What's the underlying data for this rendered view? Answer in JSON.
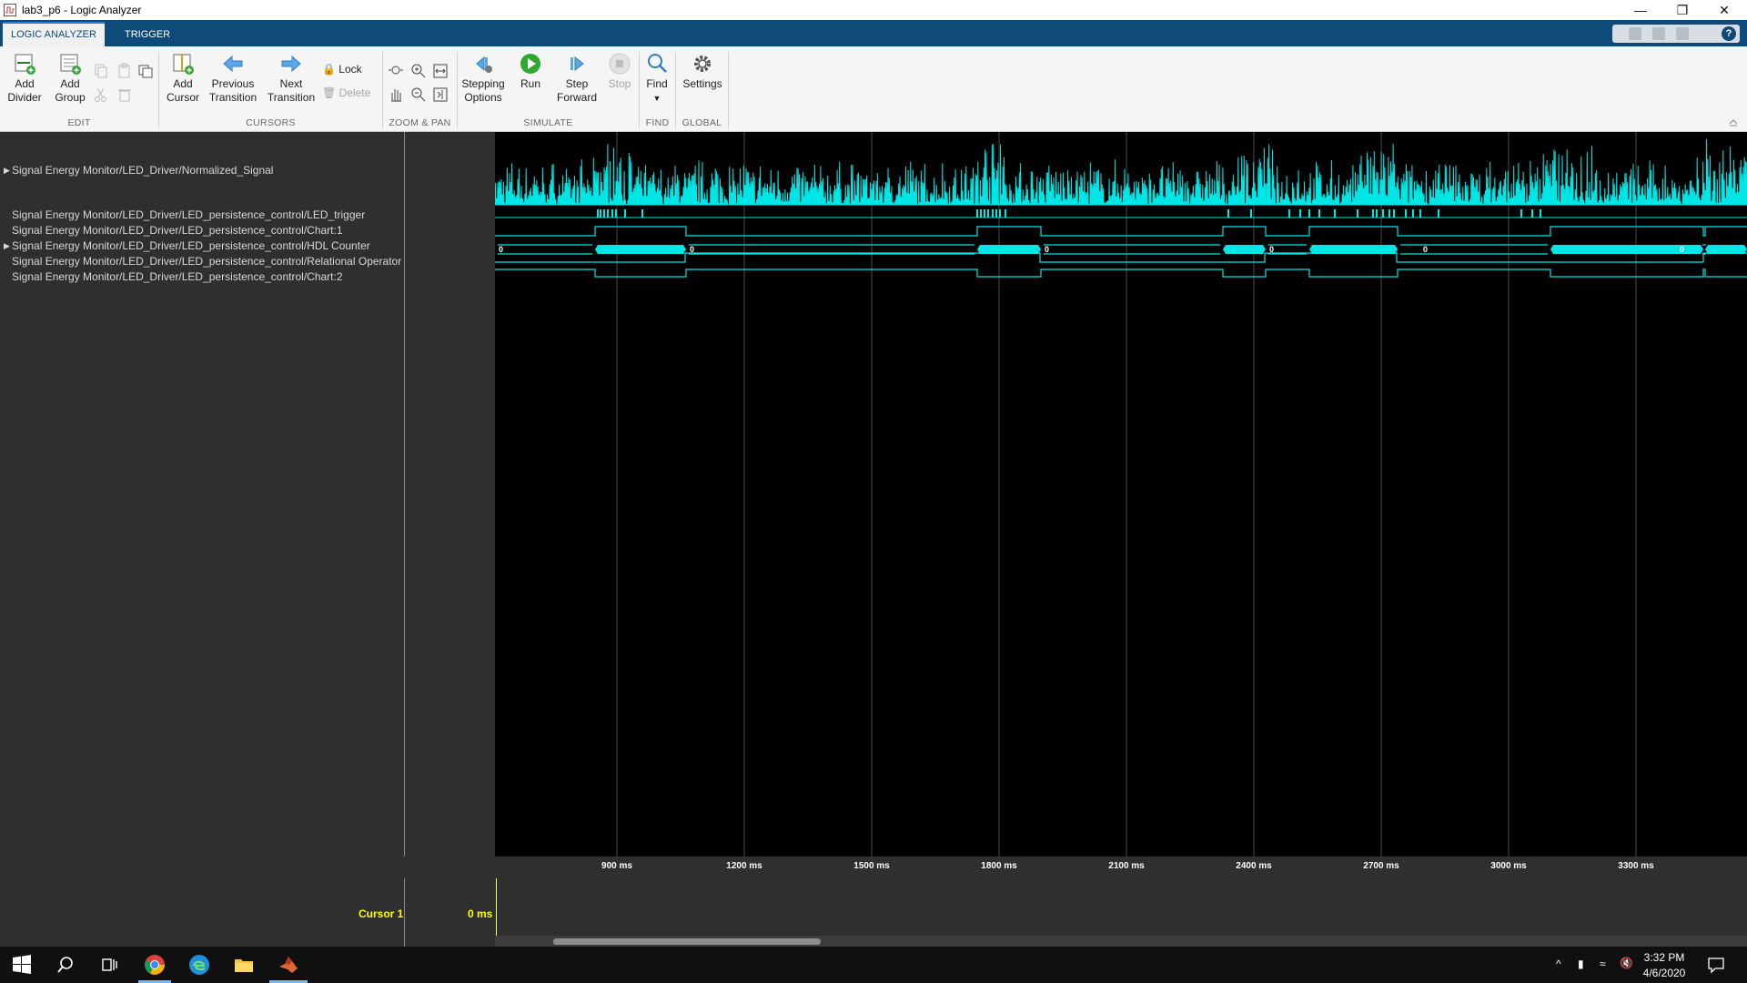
{
  "window": {
    "title": "lab3_p6 - Logic Analyzer",
    "minimize": "—",
    "restore": "❐",
    "close": "✕"
  },
  "tabs": [
    {
      "label": "LOGIC ANALYZER"
    },
    {
      "label": "TRIGGER"
    }
  ],
  "help": "?",
  "toolstrip": {
    "edit": {
      "section": "EDIT",
      "add_divider": [
        "Add",
        "Divider"
      ],
      "add_group": [
        "Add",
        "Group"
      ]
    },
    "cursors": {
      "section": "CURSORS",
      "add_cursor": [
        "Add",
        "Cursor"
      ],
      "previous_transition": [
        "Previous",
        "Transition"
      ],
      "next_transition": [
        "Next",
        "Transition"
      ],
      "lock": "Lock",
      "delete": "Delete"
    },
    "zoom": {
      "section": "ZOOM & PAN"
    },
    "simulate": {
      "section": "SIMULATE",
      "stepping_options": [
        "Stepping",
        "Options"
      ],
      "run": "Run",
      "step_forward": [
        "Step",
        "Forward"
      ],
      "stop": "Stop"
    },
    "find": {
      "section": "FIND",
      "label": "Find"
    },
    "global": {
      "section": "GLOBAL",
      "settings": "Settings"
    }
  },
  "signals": [
    "Signal Energy Monitor/LED_Driver/Normalized_Signal",
    "Signal Energy Monitor/LED_Driver/LED_persistence_control/LED_trigger",
    "Signal Energy Monitor/LED_Driver/LED_persistence_control/Chart:1",
    "Signal Energy Monitor/LED_Driver/LED_persistence_control/HDL Counter",
    "Signal Energy Monitor/LED_Driver/LED_persistence_control/Relational Operator",
    "Signal Energy Monitor/LED_Driver/LED_persistence_control/Chart:2"
  ],
  "counter_labels": [
    "0",
    "0",
    "0",
    "0",
    "0",
    "0"
  ],
  "axis_ticks": [
    "900 ms",
    "1200 ms",
    "1500 ms",
    "1800 ms",
    "2100 ms",
    "2400 ms",
    "2700 ms",
    "3000 ms",
    "3300 ms"
  ],
  "cursor": {
    "label": "Cursor 1",
    "value": "0 ms"
  },
  "taskbar": {
    "time": "3:32 PM",
    "date": "4/6/2020"
  },
  "colors": {
    "trace": "#00e5e5",
    "cursor_text": "#ffff00",
    "tab_bar": "#0e4a7a"
  }
}
